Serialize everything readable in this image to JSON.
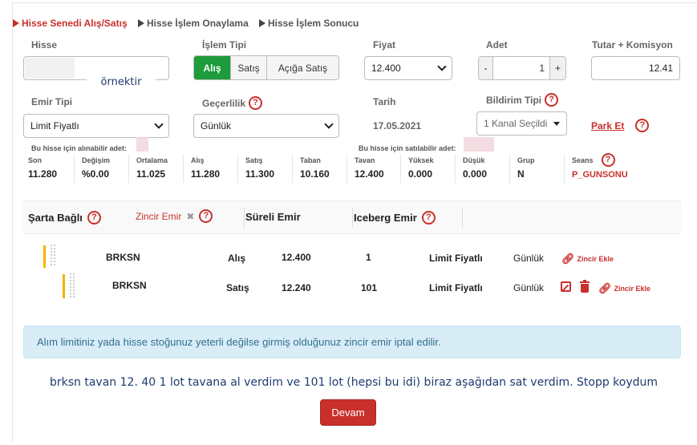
{
  "steps": [
    {
      "label": "Hisse Senedi Alış/Satış",
      "active": true
    },
    {
      "label": "Hisse İşlem Onaylama",
      "active": false
    },
    {
      "label": "Hisse İşlem Sonucu",
      "active": false
    }
  ],
  "form": {
    "hisse_label": "Hisse",
    "hisse_value": "",
    "watermark": "örnektir",
    "islem_tipi_label": "İşlem Tipi",
    "islem_tipi_options": [
      "Alış",
      "Satış",
      "Açığa Satış"
    ],
    "islem_tipi_selected": "Alış",
    "fiyat_label": "Fiyat",
    "fiyat_value": "12.400",
    "adet_label": "Adet",
    "adet_value": "1",
    "adet_minus": "-",
    "adet_plus": "+",
    "tutar_label": "Tutar + Komisyon",
    "tutar_value": "12.41",
    "emir_tipi_label": "Emir Tipi",
    "emir_tipi_value": "Limit Fiyatlı",
    "gecerlilik_label": "Geçerlilik",
    "gecerlilik_value": "Günlük",
    "tarih_label": "Tarih",
    "tarih_value": "17.05.2021",
    "bildirim_label": "Bildirim Tipi",
    "bildirim_value": "1 Kanal Seçildi",
    "park_et_label": "Park Et",
    "alinabilir_label": "Bu hisse için alınabilir adet:",
    "satilabilir_label": "Bu hisse için satılabilir adet:"
  },
  "stats": [
    {
      "label": "Son",
      "value": "11.280"
    },
    {
      "label": "Değişim",
      "value": "%0.00"
    },
    {
      "label": "Ortalama",
      "value": "11.025"
    },
    {
      "label": "Alış",
      "value": "11.280"
    },
    {
      "label": "Satış",
      "value": "11.300"
    },
    {
      "label": "Taban",
      "value": "10.160"
    },
    {
      "label": "Tavan",
      "value": "12.400"
    },
    {
      "label": "Yüksek",
      "value": "0.000"
    },
    {
      "label": "Düşük",
      "value": "0.000"
    },
    {
      "label": "Grup",
      "value": "N"
    }
  ],
  "seans": {
    "label": "Seans",
    "value": "P_GUNSONU"
  },
  "tabs": [
    {
      "label": "Şarta Bağlı",
      "active": false
    },
    {
      "label": "Zincir Emir",
      "active": true
    },
    {
      "label": "Süreli Emir",
      "active": false
    },
    {
      "label": "Iceberg Emir",
      "active": false
    }
  ],
  "orders": [
    {
      "symbol": "BRKSN",
      "side": "Alış",
      "price": "12.400",
      "qty": "1",
      "type": "Limit Fiyatlı",
      "validity": "Günlük",
      "link": "Zincir Ekle"
    },
    {
      "symbol": "BRKSN",
      "side": "Satış",
      "price": "12.240",
      "qty": "101",
      "type": "Limit Fiyatlı",
      "validity": "Günlük",
      "link": "Zincir Ekle"
    }
  ],
  "alert_text": "Alım limitiniz yada hisse stoğunuz yeterli değilse girmiş olduğunuz zincir emir iptal edilir.",
  "note_text": "brksn tavan 12. 40 1 lot tavana al verdim ve 101 lot (hepsi bu idi)  biraz aşağıdan sat verdim. Stopp koydum",
  "devam_label": "Devam",
  "colors": {
    "accent": "#c9302c",
    "green": "#1e9b3a",
    "alert_bg": "#d9edf7",
    "grip": "#f0b400"
  }
}
